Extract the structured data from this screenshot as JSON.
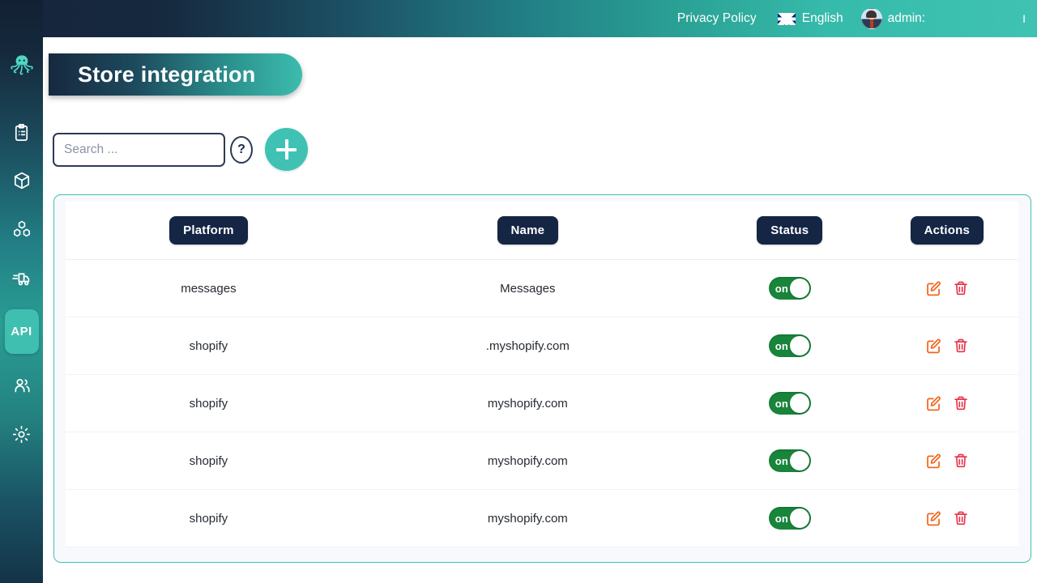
{
  "topbar": {
    "privacy_label": "Privacy Policy",
    "language": "English",
    "flag_icon": "uk-flag-icon",
    "user_label": "admin:",
    "user_value": "",
    "tail_mark": "I"
  },
  "sidebar": {
    "logo_icon": "octopus-logo-icon",
    "items": [
      {
        "icon": "clipboard-icon",
        "label": "",
        "active": false
      },
      {
        "icon": "box-icon",
        "label": "",
        "active": false
      },
      {
        "icon": "boxes-stack-icon",
        "label": "",
        "active": false
      },
      {
        "icon": "delivery-truck-icon",
        "label": "",
        "active": false
      },
      {
        "icon": "api-icon",
        "label": "API",
        "active": true
      },
      {
        "icon": "users-icon",
        "label": "",
        "active": false
      },
      {
        "icon": "gear-icon",
        "label": "",
        "active": false
      }
    ]
  },
  "page": {
    "title": "Store integration"
  },
  "search": {
    "placeholder": "Search ...",
    "value": "",
    "help_label": "?",
    "add_icon": "plus-icon"
  },
  "table": {
    "headers": [
      "Platform",
      "Name",
      "Status",
      "Actions"
    ],
    "rows": [
      {
        "platform": "messages",
        "name": "Messages",
        "status": "on",
        "edit_icon": "edit-icon",
        "delete_icon": "trash-icon"
      },
      {
        "platform": "shopify",
        "name": ".myshopify.com",
        "status": "on",
        "edit_icon": "edit-icon",
        "delete_icon": "trash-icon"
      },
      {
        "platform": "shopify",
        "name": "myshopify.com",
        "status": "on",
        "edit_icon": "edit-icon",
        "delete_icon": "trash-icon"
      },
      {
        "platform": "shopify",
        "name": "myshopify.com",
        "status": "on",
        "edit_icon": "edit-icon",
        "delete_icon": "trash-icon"
      },
      {
        "platform": "shopify",
        "name": "myshopify.com",
        "status": "on",
        "edit_icon": "edit-icon",
        "delete_icon": "trash-icon"
      }
    ]
  },
  "colors": {
    "accent_teal": "#3fc2b4",
    "header_navy": "#152544",
    "toggle_green": "#18853b",
    "edit_orange": "#f2671f",
    "delete_red": "#e8334a",
    "topbar_dark": "#15253c"
  }
}
